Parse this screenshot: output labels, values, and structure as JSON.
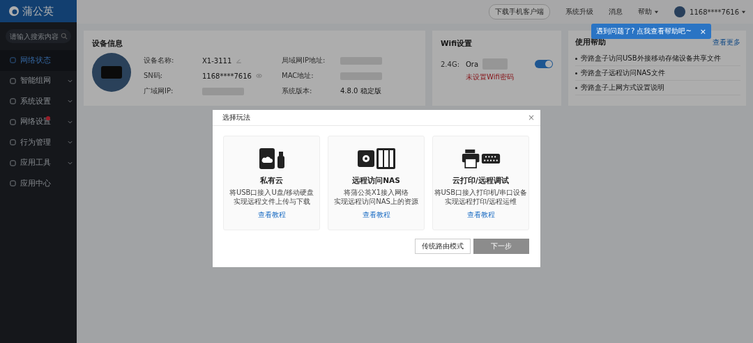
{
  "sidebar": {
    "logo": "蒲公英",
    "search": {
      "placeholder": "请输入搜索内容"
    },
    "items": [
      {
        "label": "网络状态",
        "selected": true,
        "alert": false,
        "expandable": false
      },
      {
        "label": "智能组网",
        "selected": false,
        "alert": false,
        "expandable": true
      },
      {
        "label": "系统设置",
        "selected": false,
        "alert": false,
        "expandable": true
      },
      {
        "label": "网络设置",
        "selected": false,
        "alert": true,
        "expandable": true
      },
      {
        "label": "行为管理",
        "selected": false,
        "alert": false,
        "expandable": true
      },
      {
        "label": "应用工具",
        "selected": false,
        "alert": false,
        "expandable": true
      },
      {
        "label": "应用中心",
        "selected": false,
        "alert": false,
        "expandable": false
      }
    ]
  },
  "header": {
    "download": "下载手机客户端",
    "upgrade": "系统升级",
    "messages": "消息",
    "help": "帮助",
    "account": "1168****7616"
  },
  "tooltip": {
    "text": "遇到问题了? 点我查看帮助吧~",
    "close": "×"
  },
  "device_info": {
    "title": "设备信息",
    "fields": [
      {
        "label": "设备名称:",
        "value": "X1-3111",
        "kind": "editable"
      },
      {
        "label": "SN码:",
        "value": "1168****7616",
        "kind": "masked"
      },
      {
        "label": "广域网IP:",
        "kind": "hidden"
      },
      {
        "label": "局域网IP地址:",
        "kind": "hidden"
      },
      {
        "label": "MAC地址:",
        "kind": "hidden"
      },
      {
        "label": "系统版本:",
        "value": "4.8.0 稳定版",
        "kind": "plain"
      }
    ]
  },
  "wifi": {
    "title": "Wifi设置",
    "band": "2.4G:",
    "ssid": "Ora",
    "enabled": true,
    "warning": "未设置Wifi密码"
  },
  "help_card": {
    "title": "使用帮助",
    "more": "查看更多",
    "items": [
      "旁路盒子访问USB外接移动存储设备共享文件",
      "旁路盒子远程访问NAS文件",
      "旁路盒子上网方式设置说明"
    ]
  },
  "modal": {
    "title": "选择玩法",
    "close": "×",
    "options": [
      {
        "kind": "cloud",
        "title": "私有云",
        "lines": [
          "将USB口接入U盘/移动硬盘",
          "实现远程文件上传与下载"
        ],
        "link": "查看教程"
      },
      {
        "kind": "nas",
        "title": "远程访问NAS",
        "lines": [
          "将蒲公英X1接入网络",
          "实现远程访问NAS上的资源"
        ],
        "link": "查看教程"
      },
      {
        "kind": "print",
        "title": "云打印/远程调试",
        "lines": [
          "将USB口接入打印机/串口设备",
          "实现远程打印/远程运维"
        ],
        "link": "查看教程"
      }
    ],
    "secondary": "传统路由模式",
    "primary": {
      "label": "下一步",
      "disabled": true
    }
  }
}
